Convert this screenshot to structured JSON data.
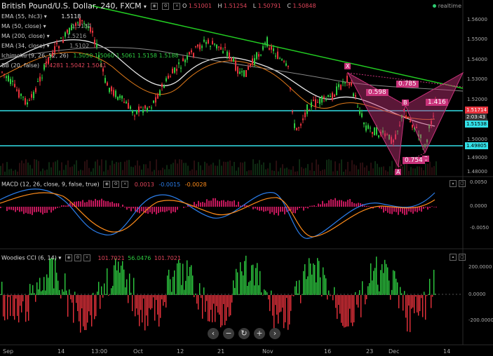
{
  "header": {
    "title": "British Pound/U.S. Dollar, 240, FXCM",
    "open_label": "O",
    "open": "1.51001",
    "high_label": "H",
    "high": "1.51254",
    "low_label": "L",
    "low": "1.50791",
    "close_label": "C",
    "close": "1.50848",
    "realtime": "realtime"
  },
  "indicators": [
    {
      "label": "EMA (55, hlc3)",
      "value": "1.5118"
    },
    {
      "label": "MA (50, close)",
      "value": "1.5139"
    },
    {
      "label": "MA (200, close)",
      "value": "1.5216"
    },
    {
      "label": "EMA (34, close)",
      "value": "1.5102"
    },
    {
      "label": "Ichimoku (9, 26, 52, 26)",
      "value": "1.5050  1.5060  1.5061  1.5158  1.5188"
    },
    {
      "label": "BB (20, false)",
      "value": "1.4281  1.5042  1.5041"
    }
  ],
  "price_axis": [
    "1.56000",
    "1.55000",
    "1.54000",
    "1.53000",
    "1.52000",
    "1.51000",
    "1.50000",
    "1.49000",
    "1.48000"
  ],
  "price_tags": {
    "last": "1.51714",
    "countdown": "2:03:43",
    "level1": "1.51538",
    "level2": "1.49805"
  },
  "pattern": {
    "x": "X",
    "a": "A",
    "b": "B",
    "c": "C",
    "r1": "0.598",
    "r2": "0.785",
    "r3": "1.416",
    "r4": "0.754"
  },
  "macd": {
    "title": "MACD (12, 26, close, 9, false, true)",
    "v1": "0.0013",
    "v2": "-0.0015",
    "v3": "-0.0028",
    "axis": [
      "0.0050",
      "0.0000",
      "-0.0050"
    ]
  },
  "cci": {
    "title": "Woodies CCI (6, 14)",
    "v1": "101.7021",
    "v2": "56.0476",
    "v3": "101.7021",
    "axis": [
      "200.0000",
      "0.0000",
      "-200.0000"
    ]
  },
  "time_axis": [
    "Sep",
    "14",
    "13:00",
    "Oct",
    "12",
    "21",
    "Nov",
    "16",
    "23",
    "Dec",
    "14"
  ],
  "colors": {
    "bull": "#2ecc40",
    "bear": "#e8323c",
    "cyan": "#33e0e8",
    "trend": "#22cc22",
    "pattern": "#c8327a",
    "macd_line": "#2b7de9",
    "signal_line": "#ff8c1a"
  }
}
